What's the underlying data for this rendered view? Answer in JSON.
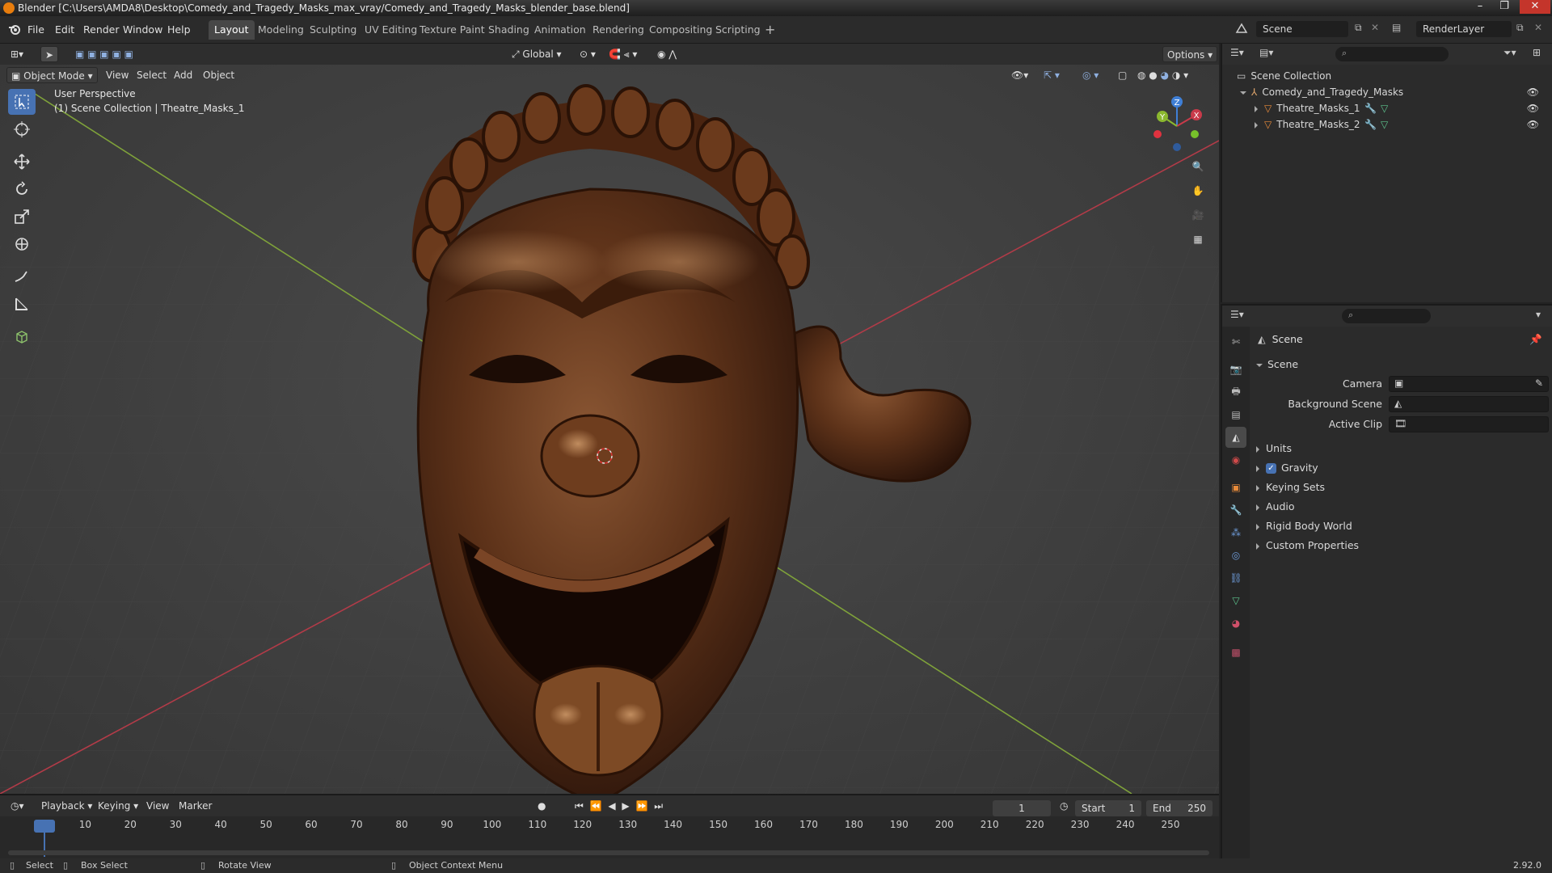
{
  "window": {
    "title": "Blender [C:\\Users\\AMDA8\\Desktop\\Comedy_and_Tragedy_Masks_max_vray/Comedy_and_Tragedy_Masks_blender_base.blend]"
  },
  "menu": {
    "file": "File",
    "edit": "Edit",
    "render": "Render",
    "window": "Window",
    "help": "Help"
  },
  "workspaces": [
    "Layout",
    "Modeling",
    "Sculpting",
    "UV Editing",
    "Texture Paint",
    "Shading",
    "Animation",
    "Rendering",
    "Compositing",
    "Scripting"
  ],
  "active_workspace": "Layout",
  "scene_selector": {
    "scene": "Scene",
    "view_layer": "RenderLayer"
  },
  "viewport": {
    "transform_orientation": "Global",
    "options_label": "Options",
    "mode": "Object Mode",
    "menus": {
      "view": "View",
      "select": "Select",
      "add": "Add",
      "object": "Object"
    },
    "overlay_title": "User Perspective",
    "overlay_subtitle": "(1) Scene Collection | Theatre_Masks_1",
    "gizmo": {
      "x": "X",
      "y": "Y",
      "z": "Z"
    }
  },
  "outliner": {
    "root": "Scene Collection",
    "collection": "Comedy_and_Tragedy_Masks",
    "objects": [
      "Theatre_Masks_1",
      "Theatre_Masks_2"
    ]
  },
  "properties": {
    "header": "Scene",
    "panel": "Scene",
    "camera_label": "Camera",
    "background_scene_label": "Background Scene",
    "active_clip_label": "Active Clip",
    "sections": [
      "Units",
      "Gravity",
      "Keying Sets",
      "Audio",
      "Rigid Body World",
      "Custom Properties"
    ],
    "gravity_checked": true
  },
  "timeline": {
    "playback": "Playback",
    "keying": "Keying",
    "view": "View",
    "marker": "Marker",
    "current_frame": "1",
    "start_label": "Start",
    "start_value": "1",
    "end_label": "End",
    "end_value": "250",
    "ticks": [
      "1",
      "10",
      "20",
      "30",
      "40",
      "50",
      "60",
      "70",
      "80",
      "90",
      "100",
      "110",
      "120",
      "130",
      "140",
      "150",
      "160",
      "170",
      "180",
      "190",
      "200",
      "210",
      "220",
      "230",
      "240",
      "250"
    ]
  },
  "statusbar": {
    "select": "Select",
    "box_select": "Box Select",
    "rotate_view": "Rotate View",
    "context_menu": "Object Context Menu",
    "version": "2.92.0"
  },
  "colors": {
    "accent": "#4772b3",
    "x_axis": "#c93a4a",
    "y_axis": "#8bb82f",
    "z_axis": "#3f7fd6",
    "playhead": "#4772b3"
  }
}
